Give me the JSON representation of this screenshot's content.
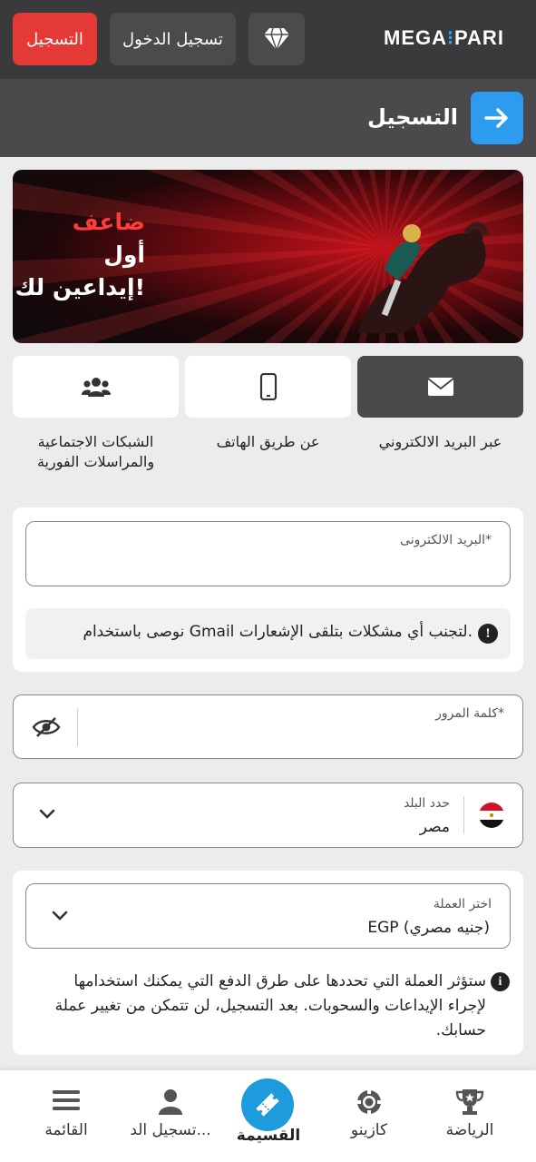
{
  "header": {
    "logo_left": "MEGA",
    "logo_sep": "⁝",
    "logo_right": "PARI",
    "register_label": "التسجيل",
    "login_label": "تسجيل الدخول"
  },
  "page": {
    "title": "التسجيل"
  },
  "banner": {
    "line1": "ضاعف",
    "line2": "أول",
    "line3": "إيداعين لك!"
  },
  "methods": [
    {
      "label": "عبر البريد الالكتروني",
      "icon": "envelope-icon",
      "active": true
    },
    {
      "label": "عن طريق الهاتف",
      "icon": "phone-icon",
      "active": false
    },
    {
      "label": "الشبكات الاجتماعية والمراسلات الفورية",
      "icon": "users-icon",
      "active": false
    }
  ],
  "form": {
    "email_label": "البريد الالكترونى*",
    "email_notice": "نوصى باستخدام Gmail لتجنب أي مشكلات بتلقى الإشعارات.",
    "password_label": "كلمة المرور*",
    "country_label": "حدد البلد",
    "country_value": "مصر",
    "currency_label": "اختر العملة",
    "currency_value": "EGP  (جنيه مصري)",
    "currency_notice": "ستؤثر العملة التي تحددها على طرق الدفع التي يمكنك استخدامها لإجراء الإيداعات والسحوبات. بعد التسجيل، لن تتمكن من تغيير عملة حسابك."
  },
  "bottom_nav": [
    {
      "label": "الرياضة",
      "icon": "trophy-icon"
    },
    {
      "label": "كازينو",
      "icon": "casino-chip-icon"
    },
    {
      "label": "القسيمة",
      "icon": "ticket-icon"
    },
    {
      "label": "تسجيل الد...",
      "icon": "user-icon"
    },
    {
      "label": "القائمة",
      "icon": "menu-icon"
    }
  ],
  "colors": {
    "accent_red": "#e53935",
    "accent_blue": "#2d9bf0",
    "header_bg": "#3a3a3c"
  }
}
